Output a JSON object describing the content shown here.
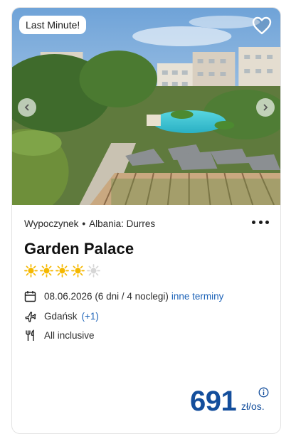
{
  "badge": {
    "label": "Last Minute!"
  },
  "hotel": {
    "operator": "Wypoczynek",
    "separator": "•",
    "location": "Albania: Durres",
    "name": "Garden Palace",
    "stars": 4,
    "stars_max": 5
  },
  "details": {
    "date": "08.06.2026 (6 dni / 4 noclegi)",
    "other_dates_link": "inne terminy",
    "departure": "Gdańsk",
    "departure_more": "(+1)",
    "board": "All inclusive"
  },
  "price": {
    "amount": "691",
    "unit": "zł/os."
  },
  "icons": [
    "heart-icon",
    "chevron-left-icon",
    "chevron-right-icon",
    "more-options-icon",
    "star-icon",
    "calendar-icon",
    "plane-icon",
    "cutlery-icon",
    "info-icon"
  ],
  "colors": {
    "accent": "#1d63b8",
    "price": "#134e9c",
    "star_on": "#f5b800",
    "star_off": "#d6d6d6"
  }
}
